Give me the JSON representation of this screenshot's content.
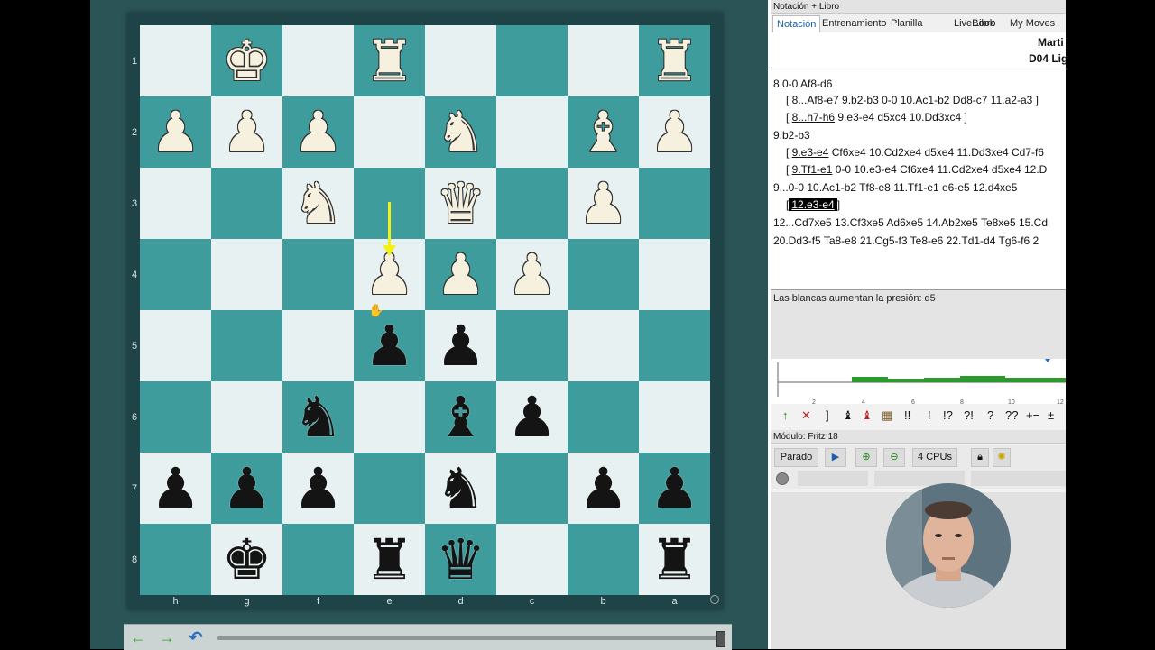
{
  "board": {
    "ranks": [
      "1",
      "2",
      "3",
      "4",
      "5",
      "6",
      "7",
      "8"
    ],
    "files": [
      "h",
      "g",
      "f",
      "e",
      "d",
      "c",
      "b",
      "a"
    ],
    "squares": [
      [
        "",
        "♚",
        "",
        "♜",
        "",
        "",
        "",
        "♜"
      ],
      [
        "♟",
        "♟",
        "♟",
        "",
        "♞",
        "",
        "♝",
        "♟"
      ],
      [
        "",
        "",
        "♞",
        "",
        "♛",
        "",
        "♟",
        ""
      ],
      [
        "",
        "",
        "",
        "♟",
        "♟",
        "♟",
        "",
        ""
      ],
      [
        "",
        "",
        "",
        "♟",
        "♟",
        "",
        "",
        ""
      ],
      [
        "",
        "",
        "♞",
        "",
        "♝",
        "♟",
        "",
        ""
      ],
      [
        "♟",
        "♟",
        "♟",
        "",
        "♞",
        "",
        "♟",
        "♟"
      ],
      [
        "",
        "♚",
        "",
        "♜",
        "♛",
        "",
        "",
        "♜"
      ]
    ],
    "colors": [
      [
        "",
        "w",
        "",
        "w",
        "",
        "",
        "",
        "w"
      ],
      [
        "w",
        "w",
        "w",
        "",
        "w",
        "",
        "w",
        "w"
      ],
      [
        "",
        "",
        "w",
        "",
        "w",
        "",
        "w",
        ""
      ],
      [
        "",
        "",
        "",
        "w",
        "w",
        "w",
        "",
        ""
      ],
      [
        "",
        "",
        "",
        "b",
        "b",
        "",
        "",
        ""
      ],
      [
        "",
        "",
        "b",
        "",
        "b",
        "b",
        "",
        ""
      ],
      [
        "b",
        "b",
        "b",
        "",
        "b",
        "",
        "b",
        "b"
      ],
      [
        "",
        "b",
        "",
        "b",
        "b",
        "",
        "",
        "b"
      ]
    ],
    "light_color": "#e8f1f1",
    "dark_color": "#3e9c9c",
    "arrow_color": "#f2f21a"
  },
  "nav": {
    "back_icon": "←",
    "forward_icon": "→",
    "undo_icon": "↶"
  },
  "notation_panel": {
    "title": "Notación + Libro",
    "tabs": [
      "Notación",
      "Entrenamiento",
      "Planilla",
      "LiveBook",
      "Libro",
      "My Moves"
    ],
    "header_player": "Marti",
    "header_eco": "D04 Lig",
    "lines": {
      "l1": "8.0-0  Af8-d6",
      "l2a": "[ ",
      "l2b": "8...Af8-e7",
      "l2c": " 9.b2-b3  0-0  10.Ac1-b2  Dd8-c7  11.a2-a3 ]",
      "l3a": "[ ",
      "l3b": "8...h7-h6",
      "l3c": " 9.e3-e4  d5xc4  10.Dd3xc4 ]",
      "l4": "9.b2-b3",
      "l5a": "[ ",
      "l5b": "9.e3-e4",
      "l5c": "  Cf6xe4  10.Cd2xe4  d5xe4  11.Dd3xe4  Cd7-f6",
      "l6a": "[ ",
      "l6b": "9.Tf1-e1",
      "l6c": "  0-0  10.e3-e4  Cf6xe4  11.Cd2xe4  d5xe4  12.D",
      "l7": "9...0-0  10.Ac1-b2  Tf8-e8  11.Tf1-e1  e6-e5  12.d4xe5",
      "l8a": "[",
      "l8b": "12.e3-e4",
      "l8c": "]",
      "l9": "12...Cd7xe5  13.Cf3xe5  Ad6xe5  14.Ab2xe5  Te8xe5  15.Cd",
      "l10": "20.Dd3-f5  Ta8-e8  21.Cg5-f3  Te8-e6  22.Td1-d4  Tg6-f6  2"
    },
    "comment": "Las blancas aumentan la presión: d5",
    "graph_ticks": [
      "2",
      "4",
      "6",
      "8",
      "10",
      "12"
    ],
    "symbols": [
      "↑",
      "✕",
      "]",
      "♝",
      "♝",
      "▦",
      "!!",
      "!",
      "!?",
      "?!",
      "?",
      "??",
      "+−",
      "±"
    ]
  },
  "engine_panel": {
    "title": "Módulo: Fritz 18",
    "stop_label": "Parado",
    "cpus_label": "4 CPUs"
  }
}
